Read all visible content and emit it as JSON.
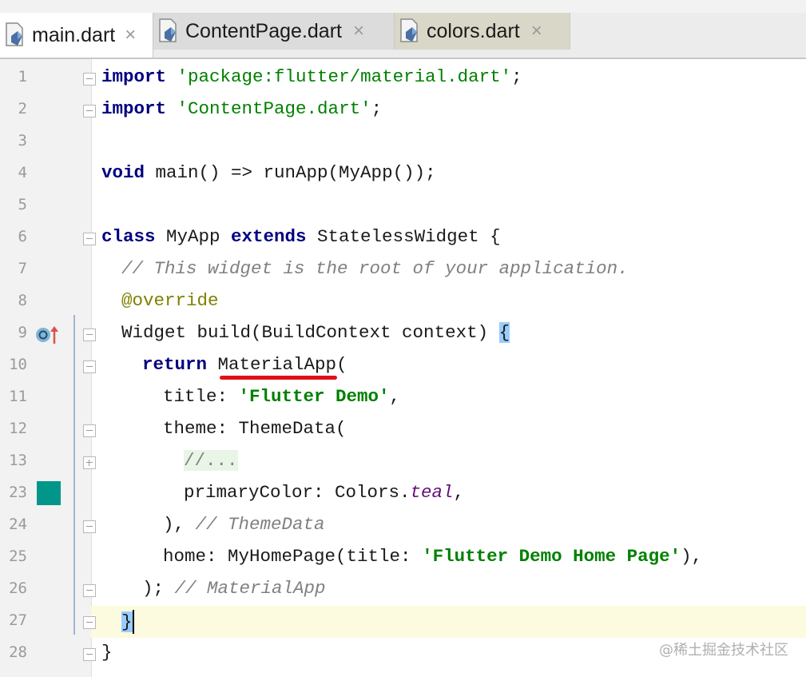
{
  "tabs": [
    {
      "label": "main.dart",
      "active": true,
      "close": "×"
    },
    {
      "label": "ContentPage.dart",
      "active": false,
      "close": "×"
    },
    {
      "label": "colors.dart",
      "active": false,
      "close": "×"
    }
  ],
  "gutter": {
    "line_numbers": [
      "1",
      "2",
      "3",
      "4",
      "5",
      "6",
      "7",
      "8",
      "9",
      "10",
      "11",
      "12",
      "13",
      "23",
      "24",
      "25",
      "26",
      "27",
      "28"
    ],
    "color_swatch": "#00968a",
    "override_icon": "override-method-icon"
  },
  "code": {
    "l1": {
      "kw": "import",
      "str": "'package:flutter/material.dart'",
      "end": ";"
    },
    "l2": {
      "kw": "import",
      "str": "'ContentPage.dart'",
      "end": ";"
    },
    "l4": {
      "kw": "void",
      "rest": " main() => runApp(MyApp());"
    },
    "l6": {
      "kw1": "class",
      "mid1": " MyApp ",
      "kw2": "extends",
      "mid2": " StatelessWidget {"
    },
    "l7": {
      "cmt": "// This widget is the root of your application."
    },
    "l8": {
      "ann": "@override"
    },
    "l9": {
      "text": "Widget build(BuildContext context) ",
      "brace": "{"
    },
    "l10": {
      "kw": "return",
      "cls": "MaterialApp",
      "end": "("
    },
    "l11": {
      "key": "title: ",
      "str": "'Flutter Demo'",
      "end": ","
    },
    "l12": {
      "text": "theme: ThemeData("
    },
    "l13": {
      "fold": "//..."
    },
    "l23": {
      "text": "primaryColor: Colors.",
      "field": "teal",
      "end": ","
    },
    "l24": {
      "text": "), ",
      "cmt": "// ThemeData"
    },
    "l25": {
      "text": "home: MyHomePage(title: ",
      "str": "'Flutter Demo Home Page'",
      "end": "),"
    },
    "l26": {
      "text": "); ",
      "cmt": "// MaterialApp"
    },
    "l27": {
      "brace": "}"
    },
    "l28": {
      "text": "}"
    }
  },
  "watermark": "@稀土掘金技术社区",
  "colors": {
    "underline": "#e0101a",
    "swatch": "#00968a",
    "current_line": "#fcfadf"
  }
}
